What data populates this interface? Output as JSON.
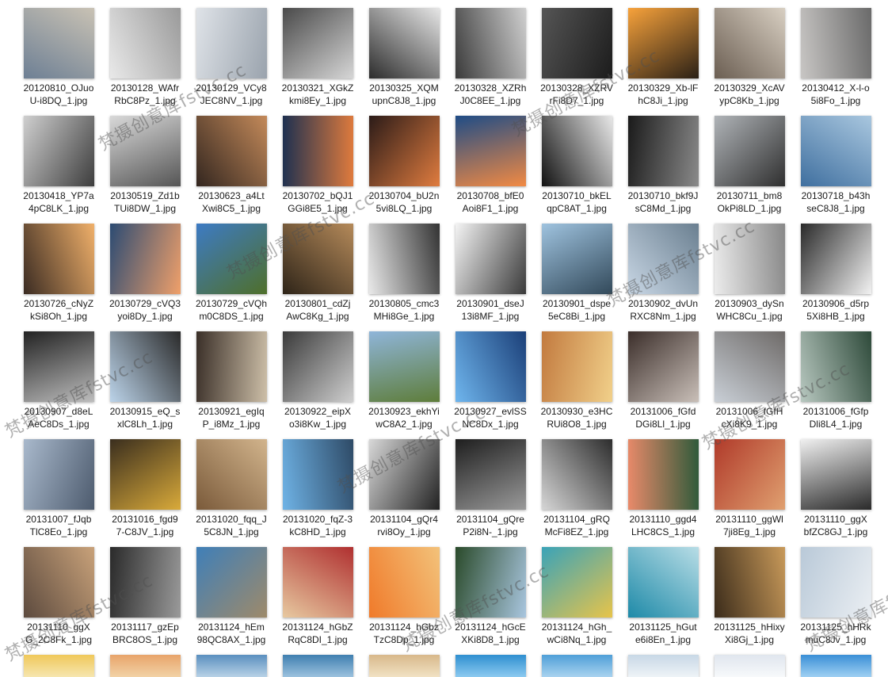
{
  "files": [
    [
      "20120810_OJuo",
      "U-i8DQ_1.jpg"
    ],
    [
      "20130128_WAfr",
      "RbC8Pz_1.jpg"
    ],
    [
      "20130129_VCy8",
      "JEC8NV_1.jpg"
    ],
    [
      "20130321_XGkZ",
      "kmi8Ey_1.jpg"
    ],
    [
      "20130325_XQM",
      "upnC8J8_1.jpg"
    ],
    [
      "20130328_XZRh",
      "J0C8EE_1.jpg"
    ],
    [
      "20130328_XZRV",
      "rFi8D7_1.jpg"
    ],
    [
      "20130329_Xb-lF",
      "hC8Ji_1.jpg"
    ],
    [
      "20130329_XcAV",
      "ypC8Kb_1.jpg"
    ],
    [
      "20130412_X-l-o",
      "5i8Fo_1.jpg"
    ],
    [
      "20130418_YP7a",
      "4pC8LK_1.jpg"
    ],
    [
      "20130519_Zd1b",
      "TUi8DW_1.jpg"
    ],
    [
      "20130623_a4Lt",
      "Xwi8C5_1.jpg"
    ],
    [
      "20130702_bQJ1",
      "GGi8E5_1.jpg"
    ],
    [
      "20130704_bU2n",
      "5vi8LQ_1.jpg"
    ],
    [
      "20130708_bfE0",
      "Aoi8F1_1.jpg"
    ],
    [
      "20130710_bkEL",
      "qpC8AT_1.jpg"
    ],
    [
      "20130710_bkf9J",
      "sC8Md_1.jpg"
    ],
    [
      "20130711_bm8",
      "OkPi8LD_1.jpg"
    ],
    [
      "20130718_b43h",
      "seC8J8_1.jpg"
    ],
    [
      "20130726_cNyZ",
      "kSi8Oh_1.jpg"
    ],
    [
      "20130729_cVQ3",
      "yoi8Dy_1.jpg"
    ],
    [
      "20130729_cVQh",
      "m0C8DS_1.jpg"
    ],
    [
      "20130801_cdZj",
      "AwC8Kg_1.jpg"
    ],
    [
      "20130805_cmc3",
      "MHi8Ge_1.jpg"
    ],
    [
      "20130901_dseJ",
      "13i8MF_1.jpg"
    ],
    [
      "20130901_dspe",
      "5eC8Bi_1.jpg"
    ],
    [
      "20130902_dvUn",
      "RXC8Nm_1.jpg"
    ],
    [
      "20130903_dySn",
      "WHC8Cu_1.jpg"
    ],
    [
      "20130906_d5rp",
      "5Xi8HB_1.jpg"
    ],
    [
      "20130907_d8eL",
      "AeC8Ds_1.jpg"
    ],
    [
      "20130915_eQ_s",
      "xlC8Lh_1.jpg"
    ],
    [
      "20130921_egIq",
      "P_i8Mz_1.jpg"
    ],
    [
      "20130922_eipX",
      "o3i8Kw_1.jpg"
    ],
    [
      "20130923_ekhYi",
      "wC8A2_1.jpg"
    ],
    [
      "20130927_evlSS",
      "NC8Dx_1.jpg"
    ],
    [
      "20130930_e3HC",
      "RUi8O8_1.jpg"
    ],
    [
      "20131006_fGfd",
      "DGi8Ll_1.jpg"
    ],
    [
      "20131006_fGfH",
      "cXi8K9_1.jpg"
    ],
    [
      "20131006_fGfp",
      "Dli8L4_1.jpg"
    ],
    [
      "20131007_fJqb",
      "TlC8Eo_1.jpg"
    ],
    [
      "20131016_fgd9",
      "7-C8JV_1.jpg"
    ],
    [
      "20131020_fqq_J",
      "5C8JN_1.jpg"
    ],
    [
      "20131020_fqZ-3",
      "kC8HD_1.jpg"
    ],
    [
      "20131104_gQr4",
      "rvi8Oy_1.jpg"
    ],
    [
      "20131104_gQre",
      "P2i8N-_1.jpg"
    ],
    [
      "20131104_gRQ",
      "McFi8EZ_1.jpg"
    ],
    [
      "20131110_ggd4",
      "LHC8CS_1.jpg"
    ],
    [
      "20131110_ggWl",
      "7ji8Eg_1.jpg"
    ],
    [
      "20131110_ggX",
      "bfZC8GJ_1.jpg"
    ],
    [
      "20131110_ggX",
      "G_2C8Fk_1.jpg"
    ],
    [
      "20131117_gzEp",
      "BRC8OS_1.jpg"
    ],
    [
      "20131124_hEm",
      "98QC8AX_1.jpg"
    ],
    [
      "20131124_hGbZ",
      "RqC8DI_1.jpg"
    ],
    [
      "20131124_hGbz",
      "TzC8Dp_1.jpg"
    ],
    [
      "20131124_hGcE",
      "XKi8D8_1.jpg"
    ],
    [
      "20131124_hGh_",
      "wCi8Nq_1.jpg"
    ],
    [
      "20131125_hGut",
      "e6i8En_1.jpg"
    ],
    [
      "20131125_hHixy",
      "Xi8Gj_1.jpg"
    ],
    [
      "20131125_hHRk",
      "muC8Jv_1.jpg"
    ]
  ],
  "watermark_text": "梵摄创意库fstvc.cc",
  "thumb_colors": [
    [
      "#6d7f94",
      "#c9c2b4"
    ],
    [
      "#e9e9e9",
      "#9a9a9a"
    ],
    [
      "#dfe3e8",
      "#9aa3ad"
    ],
    [
      "#4a4a4a",
      "#d6d6d6"
    ],
    [
      "#2c2c2c",
      "#e6e6e6"
    ],
    [
      "#3a3a3a",
      "#cfcfcf"
    ],
    [
      "#555555",
      "#1c1c1c"
    ],
    [
      "#f7a23b",
      "#2a2016"
    ],
    [
      "#6b5e52",
      "#d8cfc2"
    ],
    [
      "#c8c6c4",
      "#6a6a6a"
    ],
    [
      "#cfcfcf",
      "#3d3d3d"
    ],
    [
      "#d9d9d9",
      "#555555"
    ],
    [
      "#33261f",
      "#c48a5a"
    ],
    [
      "#1d3050",
      "#e07b3d"
    ],
    [
      "#2b1b18",
      "#e07c3f"
    ],
    [
      "#1f4c86",
      "#f28a43"
    ],
    [
      "#111111",
      "#e8e8e8"
    ],
    [
      "#1a1a1a",
      "#8a8a8a"
    ],
    [
      "#b0b4b8",
      "#2f2f2f"
    ],
    [
      "#3f6f9f",
      "#a9c7df"
    ],
    [
      "#3a2b22",
      "#f0b06a"
    ],
    [
      "#2c4b73",
      "#f0a06a"
    ],
    [
      "#3d7bc4",
      "#4f6f2a"
    ],
    [
      "#2e2418",
      "#b58a5a"
    ],
    [
      "#e9e9e9",
      "#333333"
    ],
    [
      "#f4f4f4",
      "#3a3a3a"
    ],
    [
      "#9fc3df",
      "#32495a"
    ],
    [
      "#c9d7e5",
      "#6a7f90"
    ],
    [
      "#ececec",
      "#888888"
    ],
    [
      "#2a2a2a",
      "#f2f2f2"
    ],
    [
      "#222222",
      "#bdbdbd"
    ],
    [
      "#bcd4ea",
      "#2a2a2a"
    ],
    [
      "#3a2f28",
      "#cdbfa8"
    ],
    [
      "#3a3a3a",
      "#cfcfcf"
    ],
    [
      "#8fb5d9",
      "#5e7d3a"
    ],
    [
      "#6fb6ee",
      "#1b3f78"
    ],
    [
      "#c27a3f",
      "#f1d08a"
    ],
    [
      "#3b2e2a",
      "#c9bfb8"
    ],
    [
      "#c9cfd6",
      "#6e6a68"
    ],
    [
      "#b8c8c0",
      "#2e4a3a"
    ],
    [
      "#a9b9cc",
      "#4d5b6e"
    ],
    [
      "#3a2e1e",
      "#d9aa3a"
    ],
    [
      "#7a5a3a",
      "#d2b48c"
    ],
    [
      "#6fb3e6",
      "#2e4a66"
    ],
    [
      "#d8d8d8",
      "#222222"
    ],
    [
      "#1e1e1e",
      "#9a9a9a"
    ],
    [
      "#d6d6d6",
      "#2d2d2d"
    ],
    [
      "#e98a6a",
      "#2f5a3a"
    ],
    [
      "#b03a2a",
      "#e0a070"
    ],
    [
      "#f0f0f0",
      "#2a2a2a"
    ],
    [
      "#5c4a3e",
      "#c9a27a"
    ],
    [
      "#2a2a2a",
      "#9a9a9a"
    ],
    [
      "#3f7fb8",
      "#9e8a6a"
    ],
    [
      "#e7c9a0",
      "#b03030"
    ],
    [
      "#f07a2a",
      "#f3c27a"
    ],
    [
      "#2a4a2a",
      "#a9c6df"
    ],
    [
      "#3aa3b8",
      "#e7c44a"
    ],
    [
      "#1e8aa8",
      "#b8dde6"
    ],
    [
      "#3a2b1a",
      "#c99a5a"
    ],
    [
      "#b9c9d8",
      "#ebeff3"
    ]
  ],
  "partial_row_colors": [
    [
      "#f0c85a",
      "#f6e6b0"
    ],
    [
      "#e8a46a",
      "#f2d2a6"
    ],
    [
      "#5a8fbf",
      "#b8d2e6"
    ],
    [
      "#3f7fb0",
      "#9cc2de"
    ],
    [
      "#d8b88a",
      "#f1e2c4"
    ],
    [
      "#2f8fd0",
      "#8ccaf0"
    ],
    [
      "#4f9fd8",
      "#a9d3ef"
    ],
    [
      "#c8d8e6",
      "#eef3f7"
    ],
    [
      "#e0e6ee",
      "#f7f9fb"
    ],
    [
      "#3a8fd6",
      "#9fd0f2"
    ]
  ]
}
